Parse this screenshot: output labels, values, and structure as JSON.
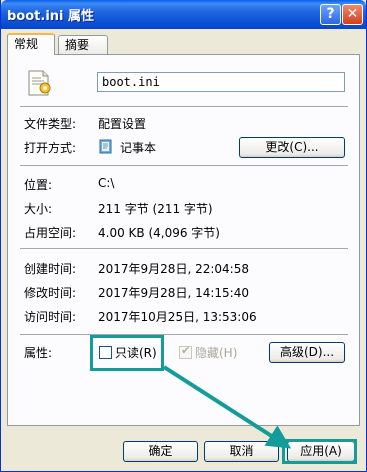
{
  "window": {
    "title": "boot.ini 属性"
  },
  "titlebar": {
    "help_symbol": "?",
    "close_symbol": "✕"
  },
  "tabs": [
    {
      "label": "常规"
    },
    {
      "label": "摘要"
    }
  ],
  "general": {
    "file_name": "boot.ini",
    "file_type_label": "文件类型:",
    "file_type_value": "配置设置",
    "opens_with_label": "打开方式:",
    "opens_with_value": "记事本",
    "change_button": "更改(C)...",
    "location_label": "位置:",
    "location_value": "C:\\",
    "size_label": "大小:",
    "size_value": "211 字节 (211 字节)",
    "size_on_disk_label": "占用空间:",
    "size_on_disk_value": "4.00 KB (4,096 字节)",
    "created_label": "创建时间:",
    "created_value": "2017年9月28日, 22:04:58",
    "modified_label": "修改时间:",
    "modified_value": "2017年9月28日, 14:15:40",
    "accessed_label": "访问时间:",
    "accessed_value": "2017年10月25日, 13:53:06",
    "attributes_label": "属性:",
    "readonly_label": "只读(R)",
    "readonly_checked": false,
    "hidden_label": "隐藏(H)",
    "hidden_checked": true,
    "advanced_button": "高级(D)..."
  },
  "footer": {
    "ok": "确定",
    "cancel": "取消",
    "apply": "应用(A)"
  },
  "colors": {
    "titlebar": "#0a5fe8",
    "highlight": "#139c9a",
    "dialog_bg": "#ece9d8"
  }
}
